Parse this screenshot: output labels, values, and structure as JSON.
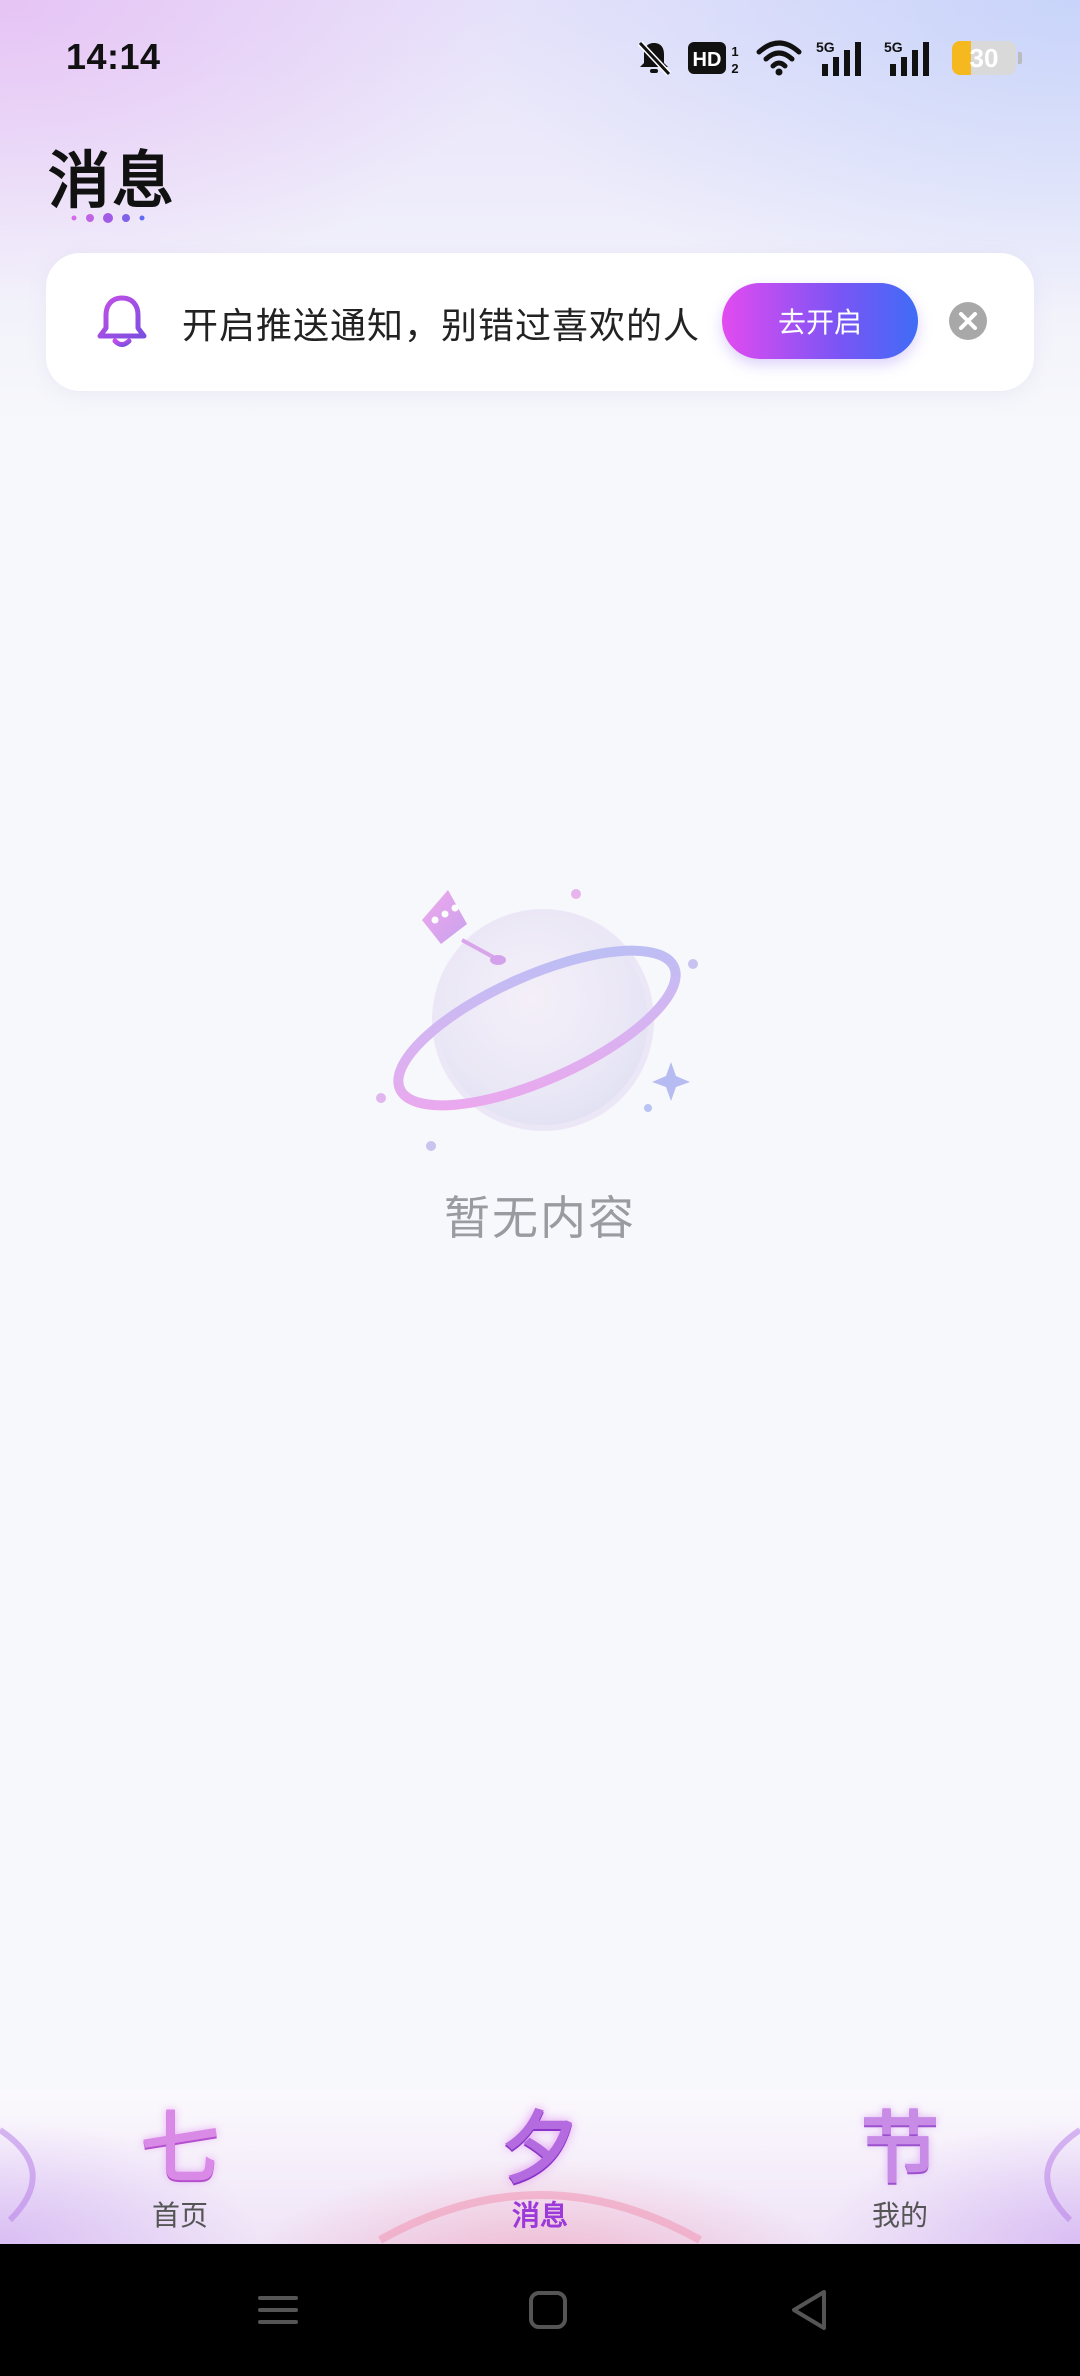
{
  "status_bar": {
    "time": "14:14",
    "icons": [
      "bell-off-icon",
      "hd-icon",
      "wifi-icon",
      "5g-signal-icon",
      "5g-signal-icon",
      "battery-icon"
    ],
    "battery_level": "30"
  },
  "header": {
    "title": "消息"
  },
  "notify_banner": {
    "icon": "bell-icon",
    "text": "开启推送通知，别错过喜欢的人",
    "button_label": "去开启",
    "close_icon": "close-icon",
    "accent_colors": [
      "#e24bf0",
      "#3f6cf6"
    ]
  },
  "empty_state": {
    "icon": "planet-icon",
    "text": "暂无内容"
  },
  "bottom_nav": {
    "items": [
      {
        "glyph": "七",
        "label": "首页",
        "active": false
      },
      {
        "glyph": "夕",
        "label": "消息",
        "active": true
      },
      {
        "glyph": "节",
        "label": "我的",
        "active": false
      }
    ],
    "active_color": "#9b3ad8"
  },
  "system_nav": {
    "buttons": [
      "menu-icon",
      "home-icon",
      "back-icon"
    ]
  }
}
